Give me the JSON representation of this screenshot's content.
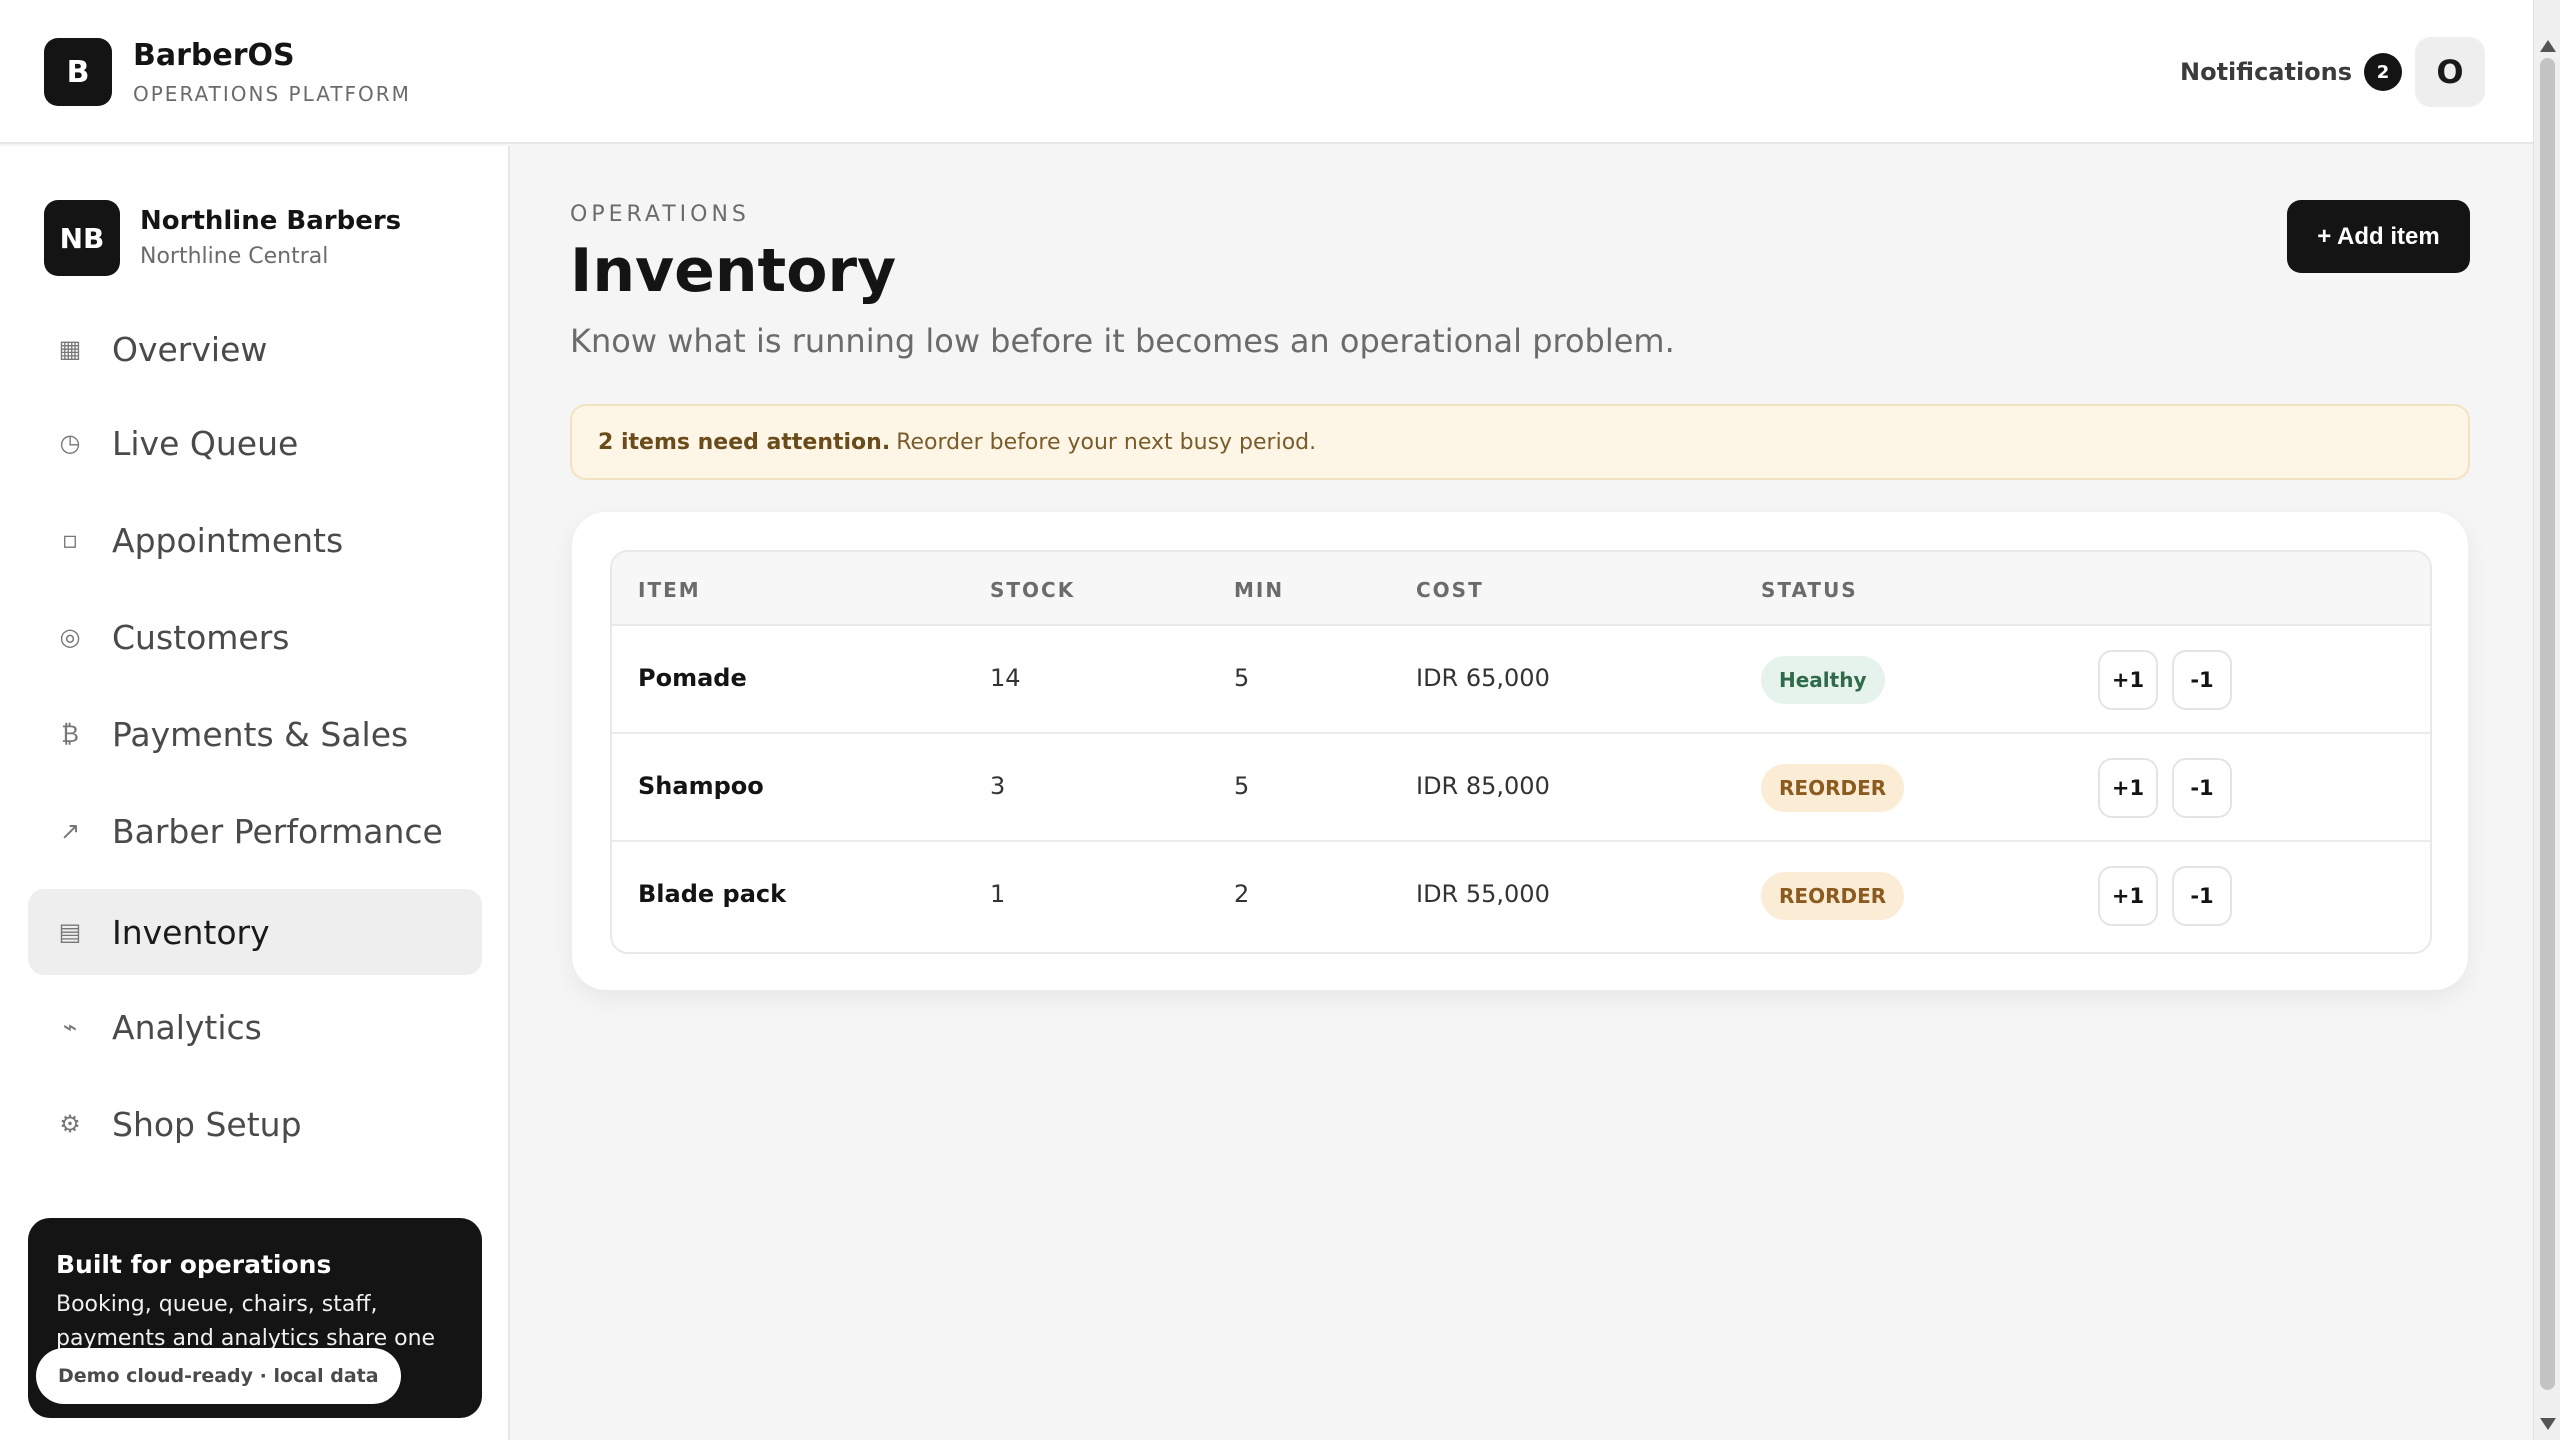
{
  "app": {
    "logo_letter": "B",
    "name": "BarberOS",
    "subtitle": "OPERATIONS PLATFORM"
  },
  "header": {
    "notifications_label": "Notifications",
    "notifications_count": "2",
    "user_initial": "O"
  },
  "shop": {
    "initials": "NB",
    "name": "Northline Barbers",
    "branch": "Northline Central"
  },
  "sidebar": {
    "items": [
      {
        "label": "Overview",
        "icon": "grid-icon",
        "glyph": "▦",
        "active": false
      },
      {
        "label": "Live Queue",
        "icon": "clock-icon",
        "glyph": "◷",
        "active": false
      },
      {
        "label": "Appointments",
        "icon": "calendar-icon",
        "glyph": "▫",
        "active": false
      },
      {
        "label": "Customers",
        "icon": "customers-icon",
        "glyph": "◎",
        "active": false
      },
      {
        "label": "Payments & Sales",
        "icon": "currency-icon",
        "glyph": "₿",
        "active": false
      },
      {
        "label": "Barber Performance",
        "icon": "trend-icon",
        "glyph": "↗",
        "active": false
      },
      {
        "label": "Inventory",
        "icon": "inventory-icon",
        "glyph": "▤",
        "active": true
      },
      {
        "label": "Analytics",
        "icon": "analytics-icon",
        "glyph": "⌁",
        "active": false
      },
      {
        "label": "Shop Setup",
        "icon": "settings-icon",
        "glyph": "⚙",
        "active": false
      }
    ],
    "promo": {
      "title": "Built for operations",
      "text": "Booking, queue, chairs, staff, payments and analytics share one operational",
      "pill": "Demo cloud-ready · local data"
    }
  },
  "page": {
    "eyebrow": "OPERATIONS",
    "title": "Inventory",
    "description": "Know what is running low before it becomes an operational problem.",
    "add_button": "+ Add item"
  },
  "alert": {
    "strong": "2 items need attention.",
    "text": "Reorder before your next busy period."
  },
  "table": {
    "columns": [
      "ITEM",
      "STOCK",
      "MIN",
      "COST",
      "STATUS"
    ],
    "rows": [
      {
        "item": "Pomade",
        "stock": "14",
        "min": "5",
        "cost": "IDR 65,000",
        "status": "Healthy",
        "status_type": "ok"
      },
      {
        "item": "Shampoo",
        "stock": "3",
        "min": "5",
        "cost": "IDR 85,000",
        "status": "REORDER",
        "status_type": "reorder"
      },
      {
        "item": "Blade pack",
        "stock": "1",
        "min": "2",
        "cost": "IDR 55,000",
        "status": "REORDER",
        "status_type": "reorder"
      }
    ],
    "increment_label": "+1",
    "decrement_label": "-1"
  }
}
